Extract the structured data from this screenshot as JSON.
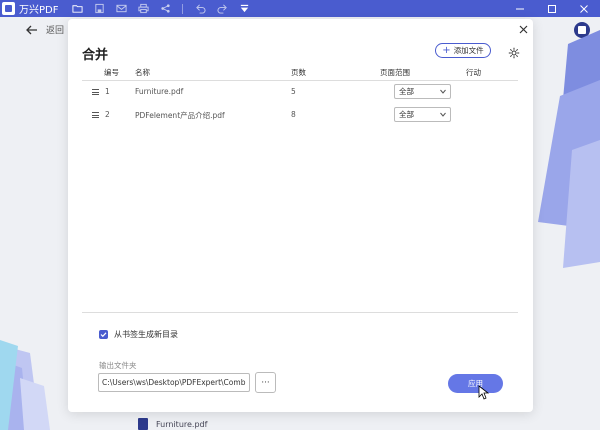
{
  "app": {
    "name": "万兴PDF"
  },
  "back": {
    "label": "返回"
  },
  "dialog": {
    "title": "合并",
    "add_file_label": "添加文件",
    "columns": {
      "index": "编号",
      "name": "名称",
      "pages": "页数",
      "page_range": "页面范围",
      "action": "行动"
    },
    "rows": [
      {
        "index": "1",
        "name": "Furniture.pdf",
        "pages": "5",
        "range": "全部"
      },
      {
        "index": "2",
        "name": "PDFelement产品介绍.pdf",
        "pages": "8",
        "range": "全部"
      }
    ],
    "bookmark_checkbox": {
      "label": "从书签生成新目录",
      "checked": true
    },
    "output_folder_label": "输出文件夹",
    "output_path": "C:\\Users\\ws\\Desktop\\PDFExpert\\Combi",
    "browse_label": "···",
    "apply_label": "应用"
  },
  "background_file": {
    "name": "Furniture.pdf"
  },
  "colors": {
    "accent": "#4a5ccf",
    "apply": "#6577e6"
  },
  "icons": [
    "app-logo-icon",
    "folder-icon",
    "save-icon",
    "mail-icon",
    "print-icon",
    "share-icon",
    "undo-icon",
    "redo-icon",
    "dropdown-menu-icon",
    "minimize-icon",
    "maximize-icon",
    "close-window-icon",
    "back-arrow-icon",
    "close-icon",
    "plus-icon",
    "settings-icon",
    "drag-handle-icon",
    "chevron-down-icon",
    "checkmark-icon",
    "pdf-file-icon",
    "cursor-icon"
  ]
}
